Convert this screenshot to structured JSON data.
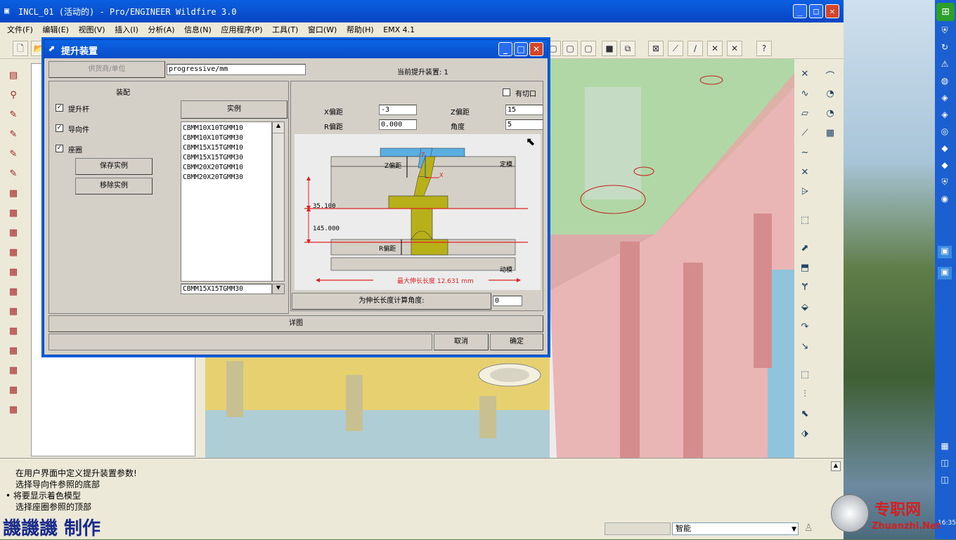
{
  "window": {
    "title": "INCL_01 (活动的) - Pro/ENGINEER Wildfire 3.0"
  },
  "menu": [
    "文件(F)",
    "编辑(E)",
    "视图(V)",
    "插入(I)",
    "分析(A)",
    "信息(N)",
    "应用程序(P)",
    "工具(T)",
    "窗口(W)",
    "帮助(H)",
    "EMX 4.1"
  ],
  "dialog": {
    "title": "提升装置",
    "supplier_btn": "供货商/单位",
    "supplier_value": "progressive/mm",
    "current_label": "当前提升装置: 1",
    "assembly_heading": "装配",
    "checks": [
      {
        "label": "提升杆",
        "checked": true
      },
      {
        "label": "导向件",
        "checked": true
      },
      {
        "label": "座圈",
        "checked": true
      }
    ],
    "save_btn": "保存实例",
    "remove_btn": "移除实例",
    "instance_heading": "实例",
    "instances": [
      "CBMM10X10TGMM10",
      "CBMM10X10TGMM30",
      "CBMM15X15TGMM10",
      "CBMM15X15TGMM30",
      "CBMM20X20TGMM10",
      "CBMM20X20TGMM30"
    ],
    "instance_selected": "CBMM15X15TGMM30",
    "cut_label": "有切口",
    "cut_checked": false,
    "x_offset_label": "X偏距",
    "x_offset_value": "-3",
    "z_offset_label": "Z偏距",
    "z_offset_value": "15",
    "r_offset_label": "R偏距",
    "r_offset_value": "0.000",
    "angle_label": "角度",
    "angle_value": "5",
    "diagram": {
      "z_offset": "Z偏距",
      "fixed": "定模",
      "dim1": "35.100",
      "dim2": "145.000",
      "r_offset": "R偏距",
      "moving": "动模",
      "max_len": "最大伸长长度 12.631 mm",
      "z_axis": "Z",
      "x_axis": "X"
    },
    "calc_label": "为伸长长度计算角度:",
    "calc_value": "0",
    "detail_btn": "详图",
    "cancel_btn": "取消",
    "ok_btn": "确定"
  },
  "messages": [
    "在用户界面中定义提升装置参数!",
    "选择导向件参照的底部",
    "• 将要显示着色模型",
    "选择座圈参照的顶部"
  ],
  "watermark": "譏譏譏 制作",
  "filter": "智能",
  "logo_cn": "专职网",
  "logo_en": "Zhuanzhi.Net",
  "clock": "16:35"
}
